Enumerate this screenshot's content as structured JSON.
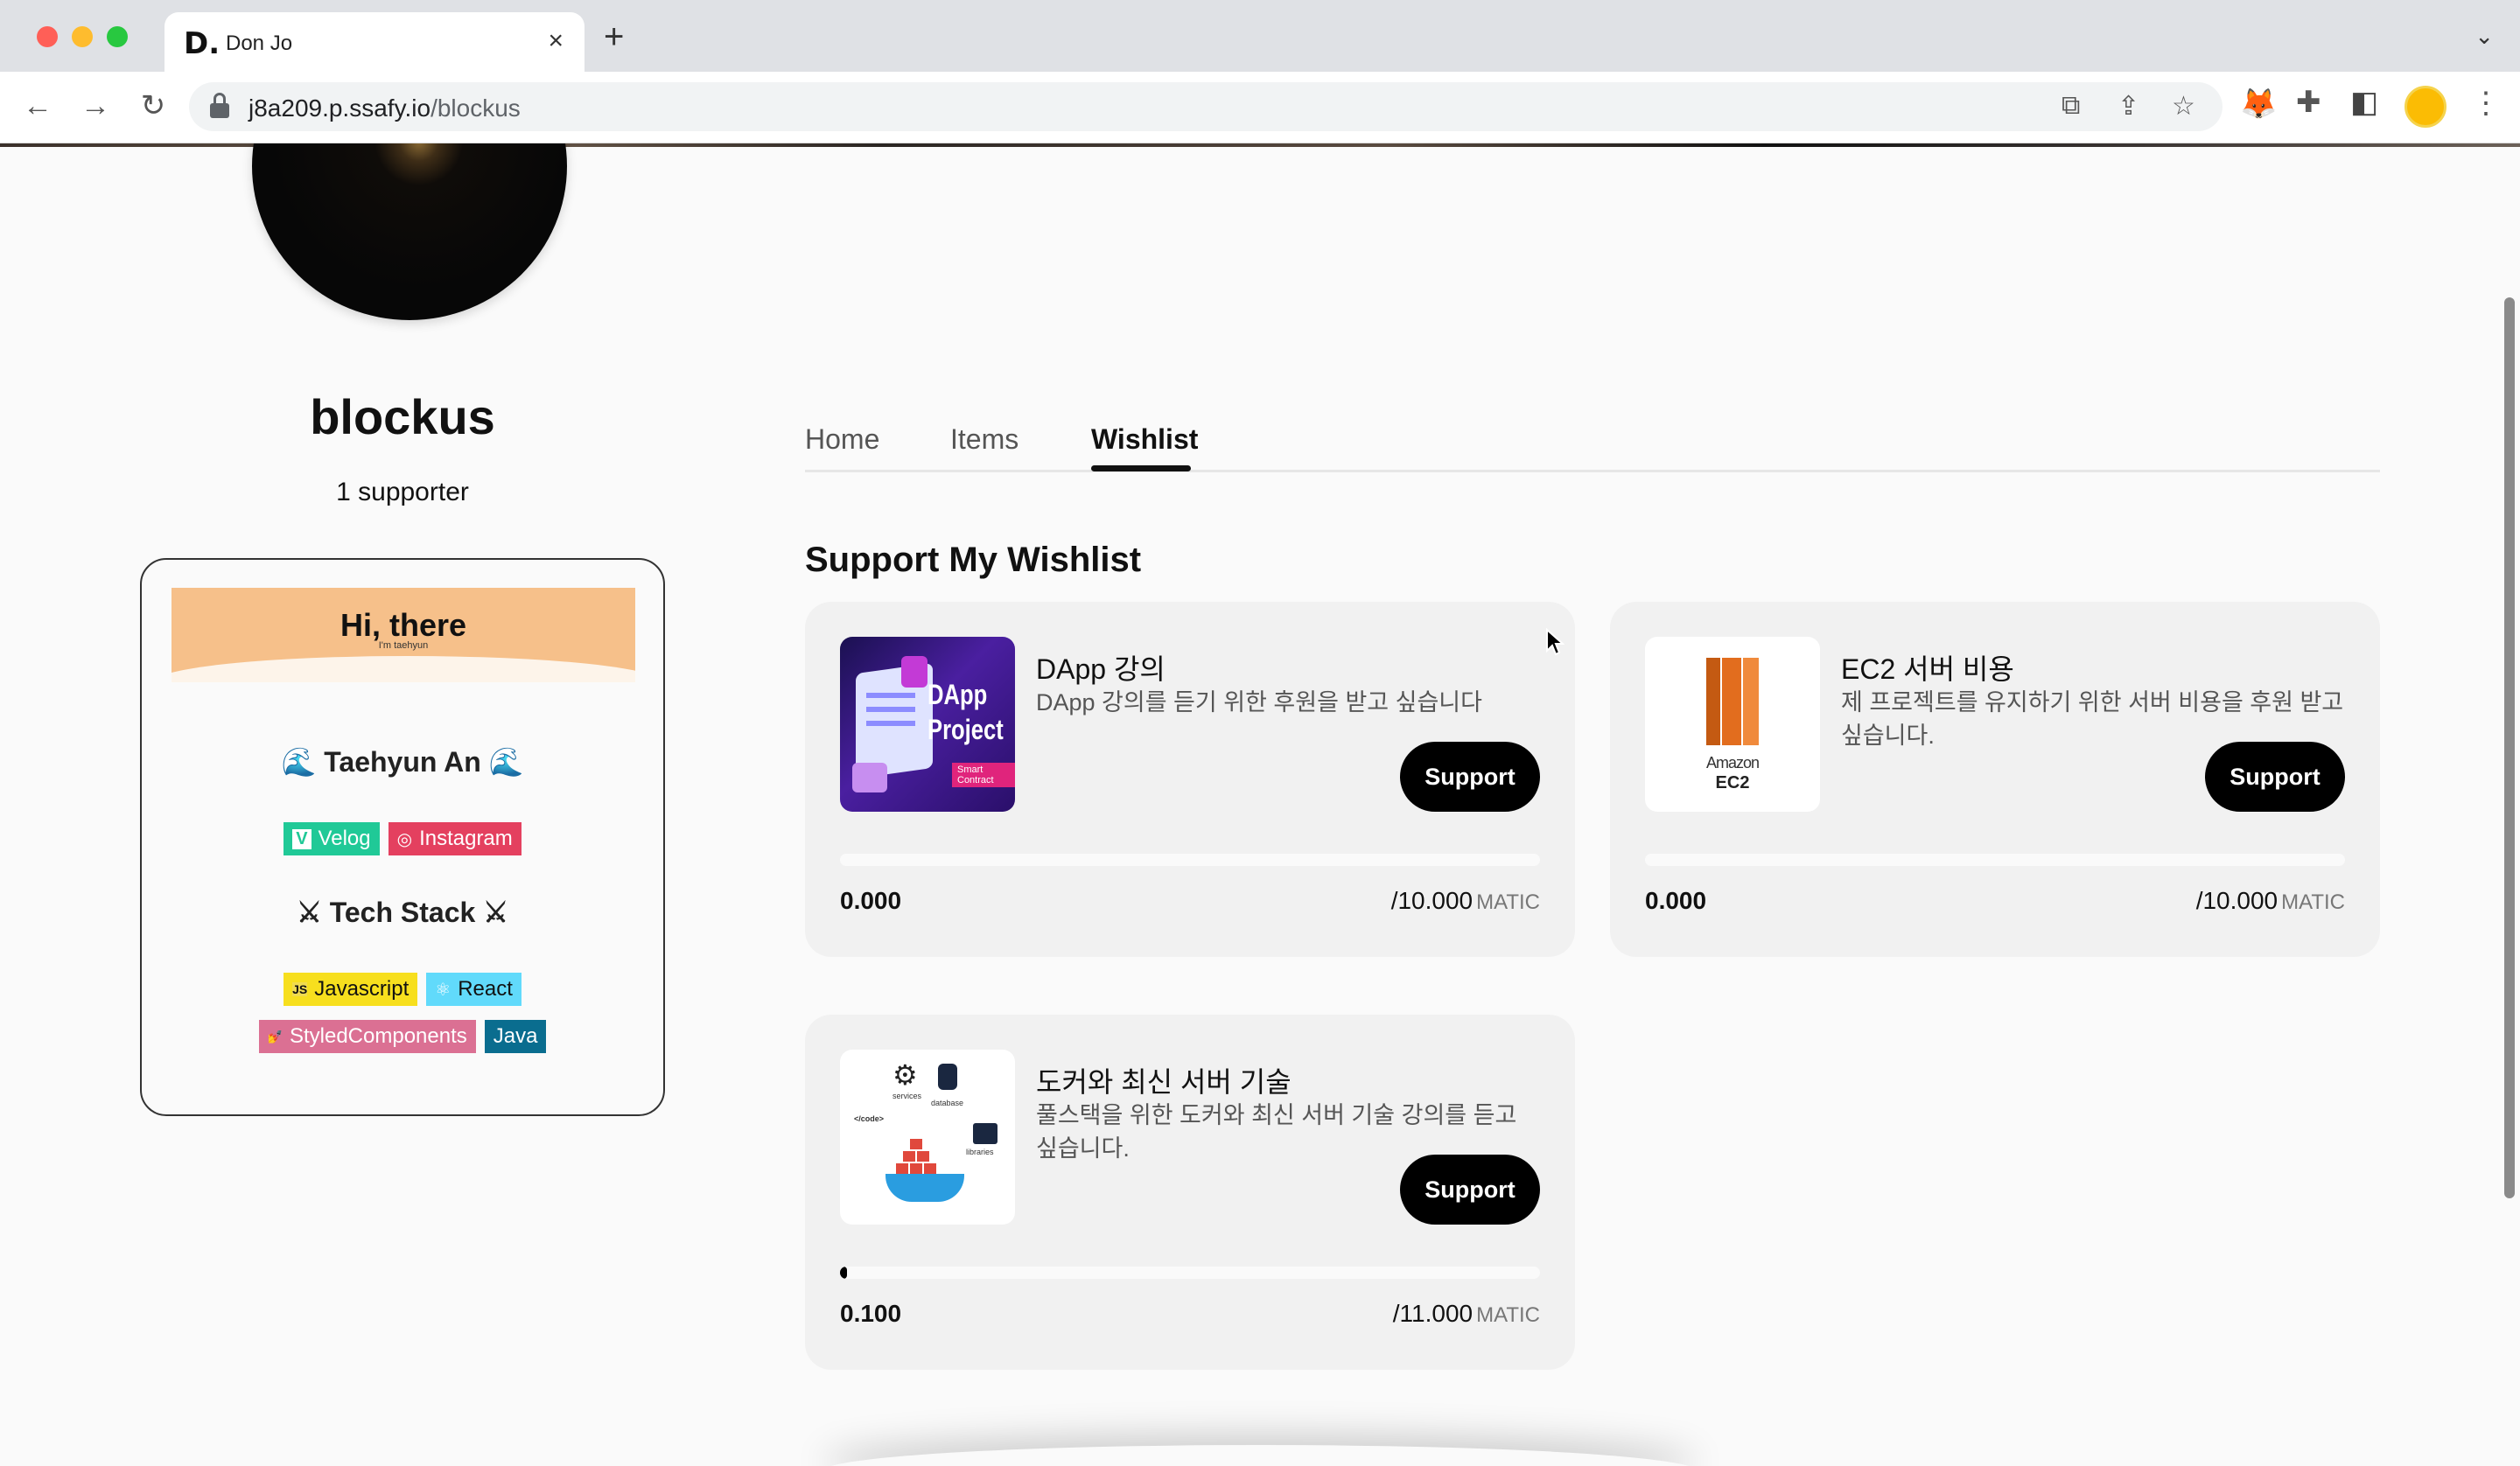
{
  "browser": {
    "tab_title": "Don Jo",
    "tab_favicon": "D.",
    "url_host": "j8a209.p.ssafy.io",
    "url_path": "/blockus",
    "icons": [
      "back-icon",
      "forward-icon",
      "reload-icon",
      "lock-icon",
      "translate-icon",
      "share-icon",
      "bookmark-star-icon",
      "metamask-fox-icon",
      "extensions-puzzle-icon",
      "side-panel-icon",
      "profile-icon",
      "menu-dots-icon"
    ]
  },
  "profile": {
    "name": "blockus",
    "supporters": "1 supporter"
  },
  "readme": {
    "hi_title": "Hi, there",
    "hi_sub": "I'm taehyun",
    "author_heading": "🌊 Taehyun An 🌊",
    "links": [
      {
        "label": "Velog",
        "icon": "V",
        "color": "#20c997"
      },
      {
        "label": "Instagram",
        "icon": "◎",
        "color": "#e4405f"
      }
    ],
    "stack_heading": "⚔ Tech Stack ⚔",
    "stack_row1": [
      {
        "label": "Javascript",
        "icon": "JS",
        "color": "#f7df1e",
        "text_color": "#111"
      },
      {
        "label": "React",
        "icon": "⚛",
        "color": "#61dafb",
        "text_color": "#111"
      }
    ],
    "stack_row2": [
      {
        "label": "StyledComponents",
        "icon": "💅",
        "color": "#db7093",
        "text_color": "#fff"
      },
      {
        "label": "Java",
        "icon": "",
        "color": "#0a6d8f",
        "text_color": "#fff"
      }
    ]
  },
  "tabs": {
    "home": "Home",
    "items": "Items",
    "wishlist": "Wishlist",
    "active": "Wishlist"
  },
  "section_title": "Support My Wishlist",
  "wishlist": [
    {
      "title": "DApp 강의",
      "description": "DApp 강의를 듣기 위한 후원을 받고 싶습니다",
      "thumb_title": "DApp Project",
      "thumb_tag": "Smart Contract",
      "button": "Support",
      "raised": "0.000",
      "goal": "/10.000",
      "unit": "MATIC",
      "progress": 0
    },
    {
      "title": "EC2 서버 비용",
      "description": "제 프로젝트를 유지하기 위한 서버 비용을 후원 받고 싶습니다.",
      "thumb_brand": "Amazon",
      "thumb_product": "EC2",
      "button": "Support",
      "raised": "0.000",
      "goal": "/10.000",
      "unit": "MATIC",
      "progress": 0
    },
    {
      "title": "도커와 최신 서버 기술",
      "description": "풀스택을 위한 도커와 최신 서버 기술 강의를 듣고 싶습니다.",
      "thumb_labels": {
        "services": "services",
        "database": "database",
        "code": "</code>",
        "libraries": "libraries"
      },
      "button": "Support",
      "raised": "0.100",
      "goal": "/11.000",
      "unit": "MATIC",
      "progress": 0.009
    }
  ]
}
